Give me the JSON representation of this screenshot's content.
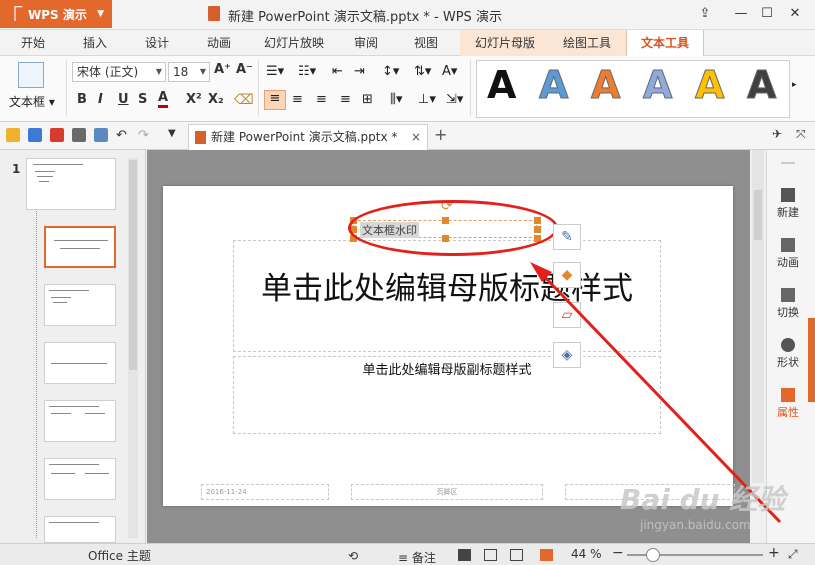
{
  "titlebar": {
    "app_name": "WPS 演示",
    "window_title": "新建 PowerPoint 演示文稿.pptx * - WPS 演示"
  },
  "tabs": [
    "开始",
    "插入",
    "设计",
    "动画",
    "幻灯片放映",
    "审阅",
    "视图",
    "幻灯片母版",
    "绘图工具",
    "文本工具"
  ],
  "active_tab": "文本工具",
  "ribbon": {
    "textbox_label": "文本框",
    "font_name": "宋体 (正文)",
    "font_size": "18",
    "format_buttons": [
      "B",
      "I",
      "U",
      "S",
      "A",
      "X²",
      "X₂"
    ],
    "font_color": "#c00000",
    "wordart_colors": [
      "#111111",
      "#5b9bd5",
      "#ed7d31",
      "#8faadc",
      "#ffc000",
      "#404040"
    ],
    "wordart_glyph": "A"
  },
  "doc_tab": {
    "label": "新建 PowerPoint 演示文稿.pptx *",
    "close": "×",
    "add": "+"
  },
  "thumbnails": {
    "master_index": "1"
  },
  "slide": {
    "title_placeholder": "单击此处编辑母版标题样式",
    "subtitle_placeholder": "单击此处编辑母版副标题样式",
    "watermark_textbox": "文本框水印",
    "footer_date": "2016-11-24",
    "footer_center": "页脚区"
  },
  "right_sidebar": [
    "新建",
    "动画",
    "切换",
    "形状",
    "属性"
  ],
  "status": {
    "theme": "Office 主题",
    "notes": "备注",
    "zoom": "44 %",
    "zoom_level_percent": 44
  },
  "watermark": {
    "brand": "Bai du 经验",
    "url": "jingyan.baidu.com"
  },
  "colors": {
    "accent": "#e2682c",
    "annotation": "#e3211b"
  }
}
